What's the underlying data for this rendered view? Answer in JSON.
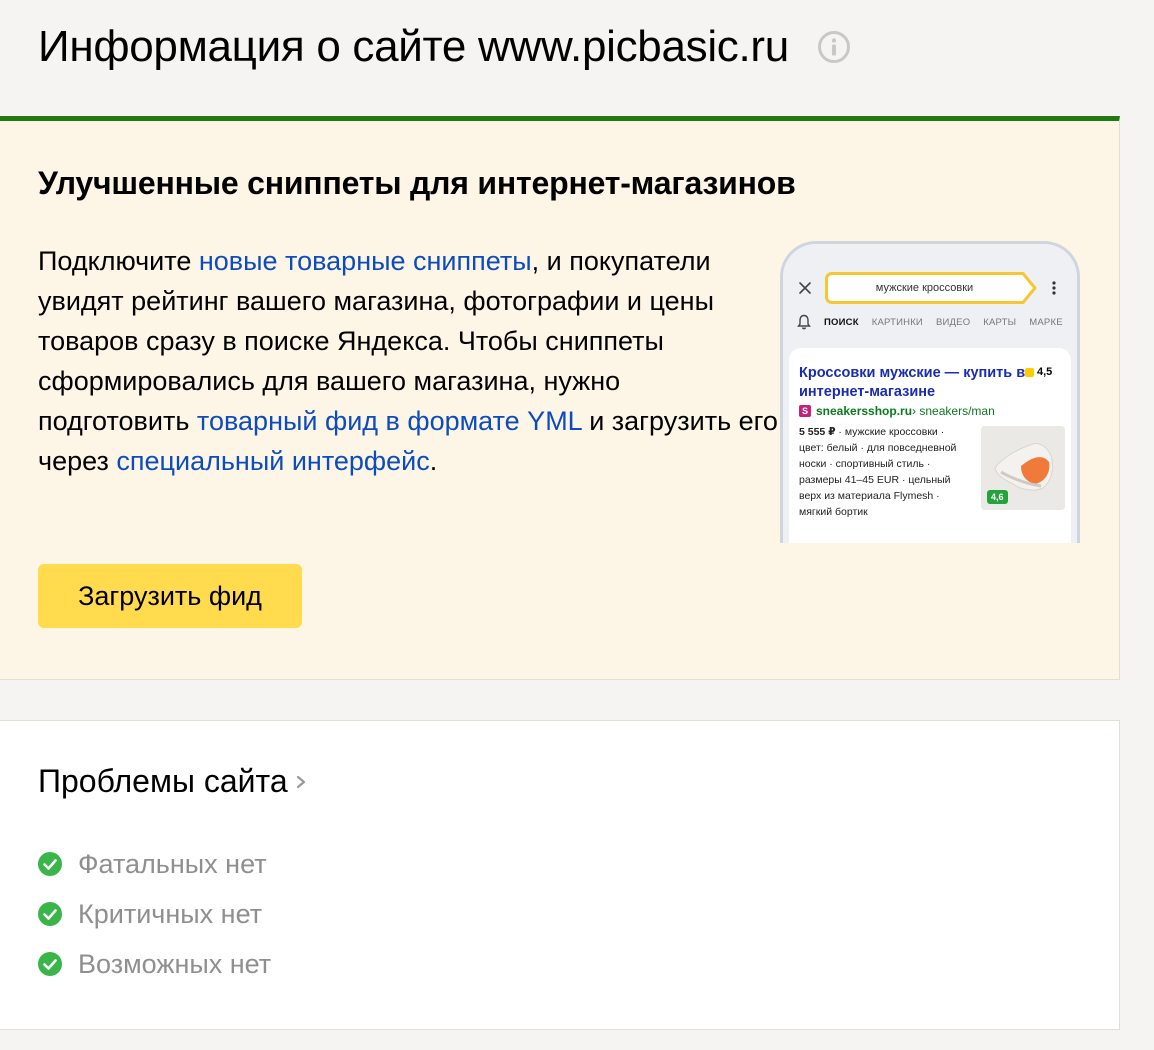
{
  "header": {
    "title": "Информация о сайте www.picbasic.ru",
    "info_icon": "info-icon"
  },
  "promo": {
    "title": "Улучшенные сниппеты для интернет-магазинов",
    "text": {
      "part1": "Подключите ",
      "link1": "новые товарные сниппеты",
      "part2": ", и покупатели увидят рейтинг вашего магазина, фотографии и цены товаров сразу в поиске Яндекса. Чтобы сниппеты сформировались для вашего магазина, нужно подготовить ",
      "link2": "товарный фид в формате YML",
      "part3": " и загрузить его через ",
      "link3": "специальный интерфейс",
      "part4": "."
    },
    "button_label": "Загрузить фид",
    "accent_border_color": "#1f7a12",
    "link_color": "#0c4cbf",
    "button_color": "#ffdb4d"
  },
  "phone_preview": {
    "search_query": "мужские кроссовки",
    "tabs": [
      "ПОИСК",
      "КАРТИНКИ",
      "ВИДЕО",
      "КАРТЫ",
      "МАРКЕ"
    ],
    "snippet": {
      "title": "Кроссовки мужские — купить в интернет-магазине",
      "rating": "4,5",
      "logo_letter": "S",
      "domain": "sneakersshop.ru",
      "path": " › sneakers/man",
      "price": "5 555 ₽",
      "description": " · мужские кроссовки · цвет: белый · для повседневной носки · спортивный стиль · размеры 41–45 EUR · цельный верх из материала Flymesh · мягкий бортик",
      "product_rating": "4,6"
    }
  },
  "problems": {
    "title": "Проблемы сайта",
    "items": [
      {
        "label": "Фатальных нет"
      },
      {
        "label": "Критичных нет"
      },
      {
        "label": "Возможных нет"
      }
    ],
    "ok_color": "#39b54a"
  }
}
